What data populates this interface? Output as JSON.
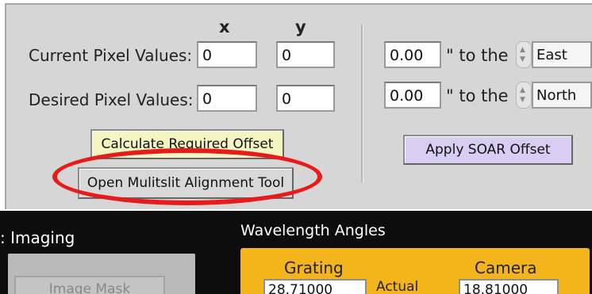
{
  "offset_panel": {
    "col_x": "x",
    "col_y": "y",
    "current_label": "Current Pixel Values:",
    "desired_label": "Desired Pixel Values:",
    "current_x": "0",
    "current_y": "0",
    "desired_x": "0",
    "desired_y": "0",
    "calc_button": "Calculate Required Offset",
    "open_multislit_button": "Open Mulitslit Alignment Tool"
  },
  "soar_offset": {
    "east_value": "0.00",
    "north_value": "0.00",
    "to_the_text": "\" to the",
    "east_dir": "East",
    "north_dir": "North",
    "apply_button": "Apply SOAR Offset"
  },
  "bottom": {
    "imaging_label": ": Imaging",
    "image_mask_button": "Image Mask",
    "wavelength_title": "Wavelength Angles",
    "grating_label": "Grating",
    "camera_label": "Camera",
    "grating_value": "28.71000",
    "camera_value": "18.81000",
    "middle_text": "Actual"
  },
  "colors": {
    "highlight_ellipse": "#e81b1b",
    "calc_button_bg": "#f5f5c3",
    "apply_button_bg": "#d9cdf3",
    "wavelength_box_bg": "#f4b41c"
  }
}
